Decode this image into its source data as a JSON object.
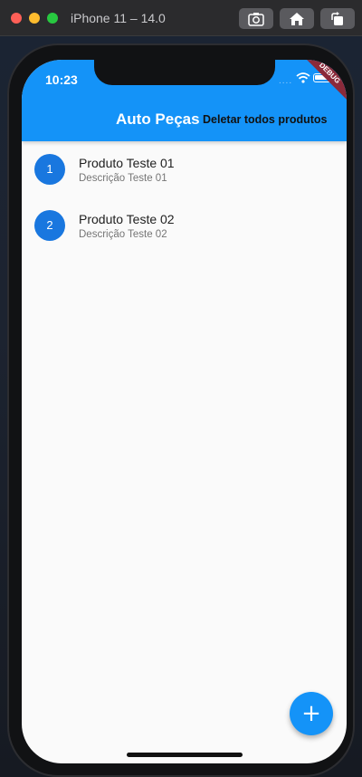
{
  "simulator": {
    "title": "iPhone 11 – 14.0",
    "buttons": [
      "screenshot-icon",
      "home-icon",
      "rotate-icon"
    ]
  },
  "status_bar": {
    "time": "10:23",
    "signal": "....",
    "debug_label": "DEBUG"
  },
  "appbar": {
    "title": "Auto Peças",
    "action_label": "Deletar todos produtos",
    "color": "#1493f8"
  },
  "products": [
    {
      "avatar": "1",
      "title": "Produto Teste 01",
      "subtitle": "Descrição Teste 01"
    },
    {
      "avatar": "2",
      "title": "Produto Teste 02",
      "subtitle": "Descrição Teste 02"
    }
  ],
  "fab": {
    "label": "+",
    "icon": "plus-icon"
  }
}
